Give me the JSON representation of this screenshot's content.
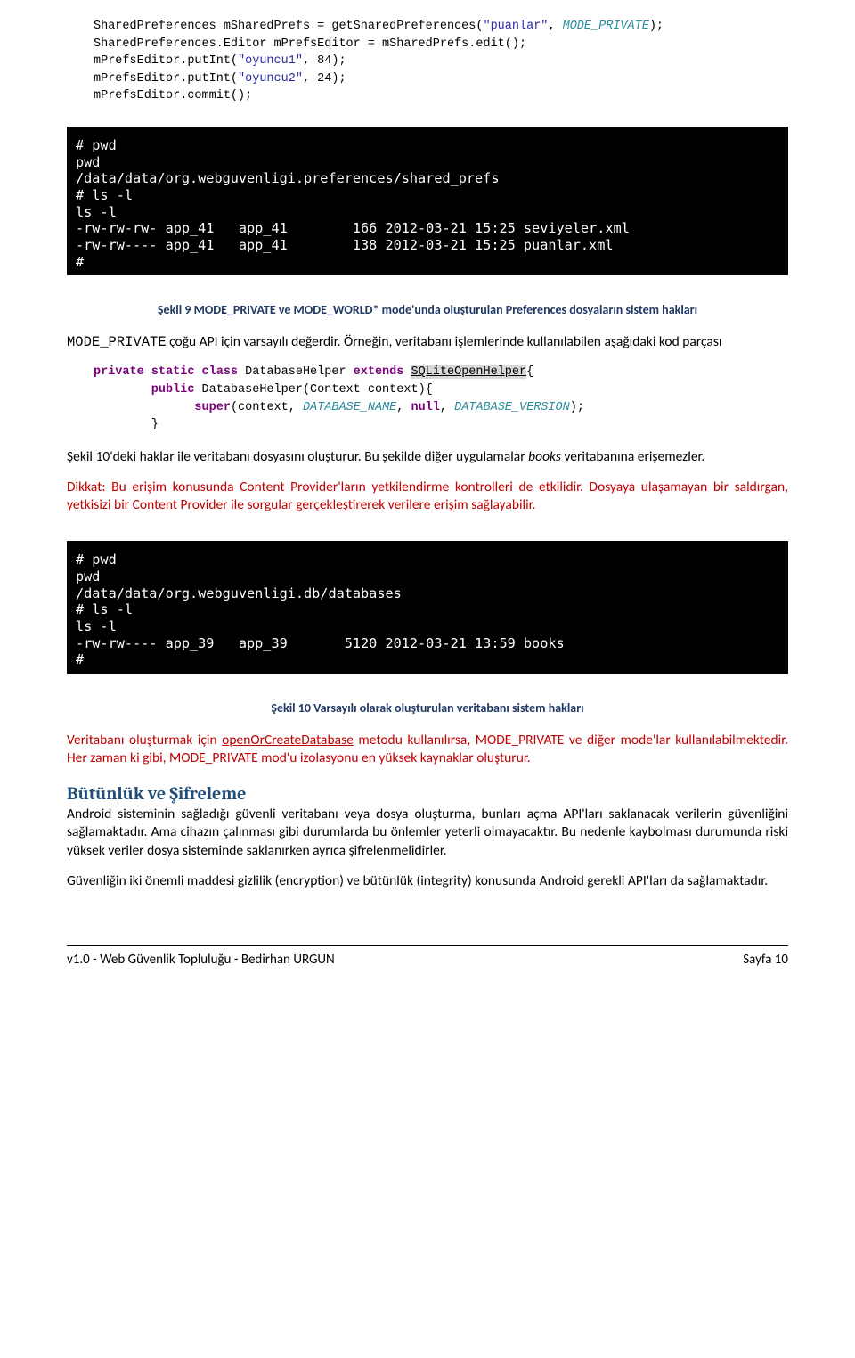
{
  "code1": {
    "l1a": "SharedPreferences mSharedPrefs = getSharedPreferences(",
    "l1b": "\"puanlar\"",
    "l1c": ", ",
    "l1d": "MODE_PRIVATE",
    "l1e": ");",
    "l2": "SharedPreferences.Editor mPrefsEditor = mSharedPrefs.edit();",
    "l3a": "mPrefsEditor.putInt(",
    "l3b": "\"oyuncu1\"",
    "l3c": ", 84);",
    "l4a": "mPrefsEditor.putInt(",
    "l4b": "\"oyuncu2\"",
    "l4c": ", 24);",
    "l5": "mPrefsEditor.commit();"
  },
  "terminal1": "# pwd\npwd\n/data/data/org.webguvenligi.preferences/shared_prefs\n# ls -l\nls -l\n-rw-rw-rw- app_41   app_41        166 2012-03-21 15:25 seviyeler.xml\n-rw-rw---- app_41   app_41        138 2012-03-21 15:25 puanlar.xml\n#",
  "caption1": "Şekil 9 MODE_PRIVATE ve MODE_WORLD* mode'unda oluşturulan Preferences dosyaların sistem hakları",
  "para1a": "MODE_PRIVATE",
  "para1b": " çoğu API için varsayılı değerdir. Örneğin, veritabanı işlemlerinde kullanılabilen aşağıdaki kod parçası",
  "code2": {
    "l1a": "private static class",
    "l1b": " DatabaseHelper ",
    "l1c": "extends",
    "l1d": " ",
    "l1e": "SQLiteOpenHelper",
    "l1f": "{",
    "l2a": "        public",
    "l2b": " DatabaseHelper(Context context){",
    "l3a": "              super",
    "l3b": "(context, ",
    "l3c": "DATABASE_NAME",
    "l3d": ", ",
    "l3e": "null",
    "l3f": ", ",
    "l3g": "DATABASE_VERSION",
    "l3h": ");",
    "l4": "        }"
  },
  "para2a": "Şekil 10'deki haklar ile veritabanı dosyasını oluşturur. Bu şekilde diğer uygulamalar ",
  "para2b": "books",
  "para2c": " veritabanına erişemezler.",
  "para3a": "Dikkat:",
  "para3b": " Bu erişim konusunda Content Provider'ların yetkilendirme kontrolleri de etkilidir. Dosyaya ulaşamayan bir saldırgan, yetkisizi bir Content Provider ile sorgular gerçekleştirerek verilere erişim sağlayabilir.",
  "terminal2": "# pwd\npwd\n/data/data/org.webguvenligi.db/databases\n# ls -l\nls -l\n-rw-rw---- app_39   app_39       5120 2012-03-21 13:59 books\n#",
  "caption2": "Şekil 10 Varsayılı olarak oluşturulan veritabanı sistem hakları",
  "para4a": "Veritabanı oluşturmak için ",
  "para4b": "openOrCreateDatabase",
  "para4c": " metodu kullanılırsa, MODE_PRIVATE ve diğer mode'lar kullanılabilmektedir. Her zaman ki gibi, MODE_PRIVATE mod'u izolasyonu en yüksek kaynaklar oluşturur.",
  "heading": "Bütünlük ve Şifreleme",
  "para5": "Android sisteminin sağladığı güvenli veritabanı veya dosya oluşturma, bunları açma API'ları saklanacak verilerin güvenliğini sağlamaktadır. Ama cihazın çalınması gibi durumlarda bu önlemler yeterli olmayacaktır. Bu nedenle kaybolması durumunda riski yüksek veriler dosya sisteminde saklanırken ayrıca şifrelenmelidirler.",
  "para6": "Güvenliğin iki önemli maddesi gizlilik (encryption) ve bütünlük (integrity) konusunda Android gerekli API'ları da sağlamaktadır.",
  "footer_left": "v1.0 - Web Güvenlik Topluluğu - Bedirhan URGUN",
  "footer_right": "Sayfa 10"
}
